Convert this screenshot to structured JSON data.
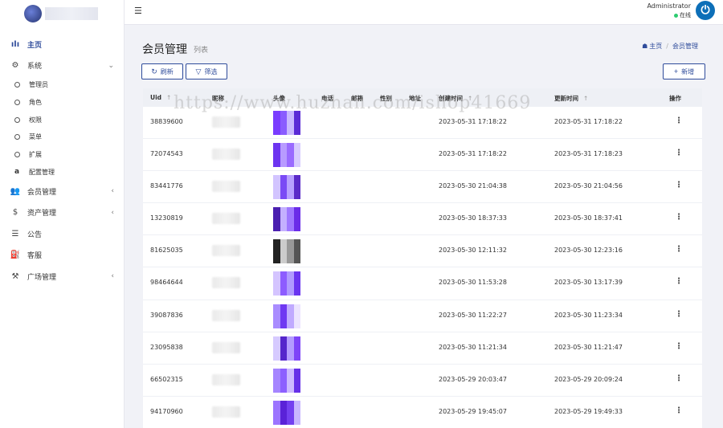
{
  "topbar": {
    "menu_toggle_icon": "hamburger-icon",
    "user_name": "Administrator",
    "user_status": "在线",
    "status_color": "#2ecc71",
    "avatar_icon": "power-icon",
    "avatar_glyph": "⏻"
  },
  "sidebar": {
    "logo_icon": "logo-mark",
    "items": [
      {
        "key": "home",
        "label": "主页",
        "icon": "bar-chart-icon",
        "glyph": "ılı",
        "active": true
      },
      {
        "key": "system",
        "label": "系统",
        "icon": "gear-icon",
        "glyph": "⚙",
        "chevron": "⌄"
      },
      {
        "key": "admin",
        "label": "管理员",
        "sub": true
      },
      {
        "key": "role",
        "label": "角色",
        "sub": true
      },
      {
        "key": "permission",
        "label": "权限",
        "sub": true
      },
      {
        "key": "menu",
        "label": "菜单",
        "sub": true
      },
      {
        "key": "extend",
        "label": "扩展",
        "sub": true
      },
      {
        "key": "config",
        "label": "配置管理",
        "sub": true,
        "icon": "a-icon",
        "glyph": "a"
      },
      {
        "key": "member",
        "label": "会员管理",
        "icon": "users-icon",
        "glyph": "👥",
        "chevron": "‹"
      },
      {
        "key": "asset",
        "label": "资产管理",
        "icon": "dollar-icon",
        "glyph": "$",
        "chevron": "‹"
      },
      {
        "key": "notice",
        "label": "公告",
        "icon": "list-icon",
        "glyph": "☰"
      },
      {
        "key": "service",
        "label": "客服",
        "icon": "service-icon",
        "glyph": "⛽"
      },
      {
        "key": "square",
        "label": "广场管理",
        "icon": "square-icon",
        "glyph": "⚒",
        "chevron": "‹"
      }
    ]
  },
  "page": {
    "title": "会员管理",
    "subtitle": "列表",
    "breadcrumb": {
      "home_icon": "dashboard-icon",
      "home_glyph": "☗",
      "home": "主页",
      "current": "会员管理"
    }
  },
  "toolbar": {
    "refresh_label": "刷新",
    "refresh_icon": "refresh-icon",
    "refresh_glyph": "↻",
    "filter_label": "筛选",
    "filter_icon": "filter-icon",
    "filter_glyph": "▽",
    "add_label": "新增",
    "add_icon": "plus-icon",
    "add_glyph": "+"
  },
  "table": {
    "columns": {
      "uid": "Uid",
      "nickname": "昵称",
      "avatar": "头像",
      "phone": "电话",
      "email": "邮箱",
      "gender": "性别",
      "address": "地址",
      "created": "创建时间",
      "updated": "更新时间",
      "actions": "操作",
      "sort_glyph": "↑"
    },
    "rows": [
      {
        "uid": "38839600",
        "created": "2023-05-31 17:18:22",
        "updated": "2023-05-31 17:18:22",
        "avatar_palette": [
          "#7a3cff",
          "#5b2bd6",
          "#c9b8ff",
          "#8a5cff"
        ]
      },
      {
        "uid": "72074543",
        "created": "2023-05-31 17:18:22",
        "updated": "2023-05-31 17:18:23",
        "avatar_palette": [
          "#b89bff",
          "#6d34f0",
          "#d8ccff",
          "#9a6bff"
        ]
      },
      {
        "uid": "83441776",
        "created": "2023-05-30 21:04:38",
        "updated": "2023-05-30 21:04:56",
        "avatar_palette": [
          "#b8a0ff",
          "#7a4af5",
          "#d2c4ff",
          "#5a2ac8"
        ]
      },
      {
        "uid": "13230819",
        "created": "2023-05-30 18:37:33",
        "updated": "2023-05-30 18:37:41",
        "avatar_palette": [
          "#6a2ce8",
          "#9f78ff",
          "#c4b0ff",
          "#4a1fb0"
        ]
      },
      {
        "uid": "81625035",
        "created": "2023-05-30 12:11:32",
        "updated": "2023-05-30 12:23:16",
        "avatar_palette": [
          "#222222",
          "#555555",
          "#999999",
          "#cccccc"
        ]
      },
      {
        "uid": "98464644",
        "created": "2023-05-30 11:53:28",
        "updated": "2023-05-30 13:17:39",
        "avatar_palette": [
          "#8d5cff",
          "#d4c4ff",
          "#6a34f0",
          "#b09aff"
        ]
      },
      {
        "uid": "39087836",
        "created": "2023-05-30 11:22:27",
        "updated": "2023-05-30 11:23:34",
        "avatar_palette": [
          "#c0aaff",
          "#6f38f2",
          "#a98cff",
          "#ece4ff"
        ]
      },
      {
        "uid": "23095838",
        "created": "2023-05-30 11:21:34",
        "updated": "2023-05-30 11:21:47",
        "avatar_palette": [
          "#7e44f8",
          "#b49cff",
          "#5526cc",
          "#d6caff"
        ]
      },
      {
        "uid": "66502315",
        "created": "2023-05-29 20:03:47",
        "updated": "2023-05-29 20:09:24",
        "avatar_palette": [
          "#a585ff",
          "#6630e8",
          "#cdbaff",
          "#8d60ff"
        ]
      },
      {
        "uid": "94170960",
        "created": "2023-05-29 19:45:07",
        "updated": "2023-05-29 19:49:33",
        "avatar_palette": [
          "#5a22d8",
          "#9c74ff",
          "#c8b6ff",
          "#7440f0"
        ]
      }
    ],
    "row_menu_icon": "more-vertical-icon",
    "row_menu_glyph": "⋮"
  },
  "watermark": "https://www.huzhan.com/ishop41669",
  "colors": {
    "accent": "#2f4c9b",
    "sidebar_bg": "#ffffff",
    "page_bg": "#f1f2f7"
  }
}
